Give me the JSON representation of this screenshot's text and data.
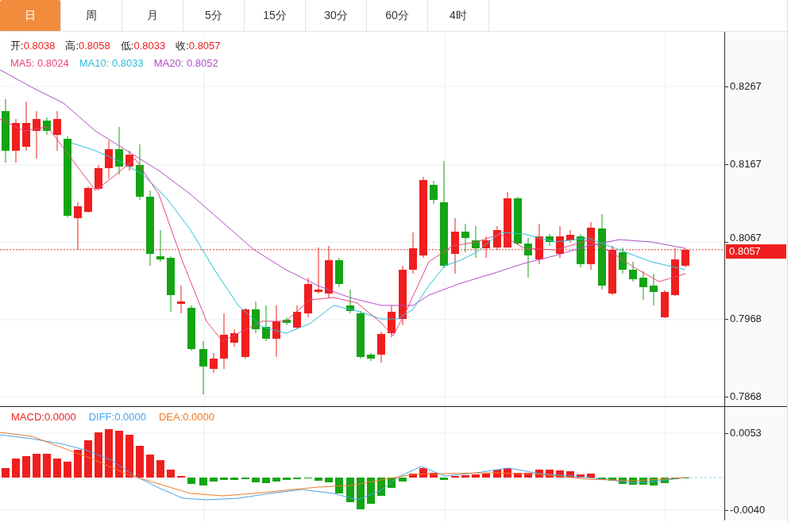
{
  "tabs": [
    {
      "label": "日",
      "selected": true
    },
    {
      "label": "周",
      "selected": false
    },
    {
      "label": "月",
      "selected": false
    },
    {
      "label": "5分",
      "selected": false
    },
    {
      "label": "15分",
      "selected": false
    },
    {
      "label": "30分",
      "selected": false
    },
    {
      "label": "60分",
      "selected": false
    },
    {
      "label": "4时",
      "selected": false
    }
  ],
  "legend": {
    "ohlc": [
      {
        "label": "开:",
        "value": "0.8038"
      },
      {
        "label": "高:",
        "value": "0.8058"
      },
      {
        "label": "低:",
        "value": "0.8033"
      },
      {
        "label": "收:",
        "value": "0.8057"
      }
    ],
    "ma": [
      {
        "label": "MA5:",
        "value": "0.8024",
        "color": "#e8457c"
      },
      {
        "label": "MA10:",
        "value": "0.8033",
        "color": "#2bbfd6"
      },
      {
        "label": "MA20:",
        "value": "0.8052",
        "color": "#b14fc5"
      }
    ]
  },
  "price_axis": {
    "ticks": [
      "0.8267",
      "0.8167",
      "0.8067",
      "0.7968",
      "0.7868"
    ],
    "current_price": "0.8057"
  },
  "macd": {
    "legend": [
      {
        "label": "MACD:",
        "value": "0.0000",
        "color": "#f02424"
      },
      {
        "label": "DIFF:",
        "value": "0.0000",
        "color": "#4aa3ea"
      },
      {
        "label": "DEA:",
        "value": "0.0000",
        "color": "#f07a24"
      }
    ],
    "ticks": [
      "0.0053",
      "-0.0040"
    ]
  }
}
